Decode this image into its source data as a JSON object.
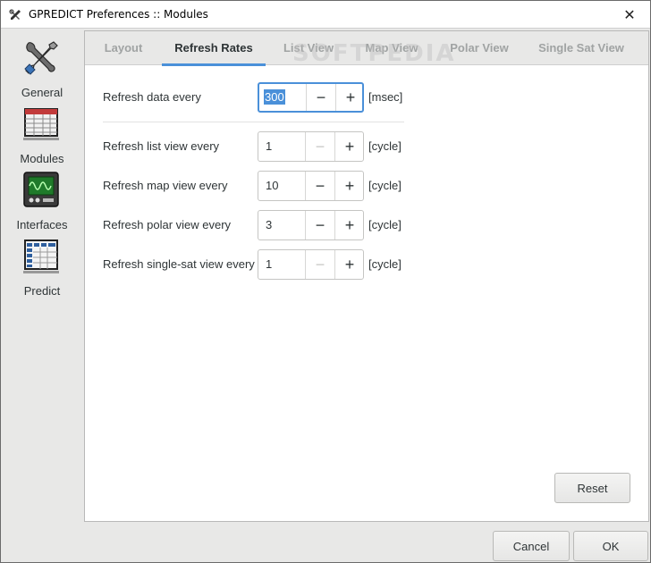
{
  "window": {
    "title": "GPREDICT Preferences :: Modules"
  },
  "sidebar": {
    "items": [
      {
        "label": "General",
        "icon": "tools-icon"
      },
      {
        "label": "Modules",
        "icon": "modules-icon"
      },
      {
        "label": "Interfaces",
        "icon": "interfaces-icon"
      },
      {
        "label": "Predict",
        "icon": "predict-icon"
      }
    ]
  },
  "tabs": [
    {
      "label": "Layout",
      "active": false
    },
    {
      "label": "Refresh Rates",
      "active": true
    },
    {
      "label": "List View",
      "active": false
    },
    {
      "label": "Map View",
      "active": false
    },
    {
      "label": "Polar View",
      "active": false
    },
    {
      "label": "Single Sat View",
      "active": false
    }
  ],
  "watermark": "SOFTPEDIA",
  "settings": {
    "data": {
      "label": "Refresh data every",
      "value": "300",
      "unit": "[msec]",
      "minus_enabled": true
    },
    "list": {
      "label": "Refresh list view every",
      "value": "1",
      "unit": "[cycle]",
      "minus_enabled": false
    },
    "map": {
      "label": "Refresh map view every",
      "value": "10",
      "unit": "[cycle]",
      "minus_enabled": true
    },
    "polar": {
      "label": "Refresh polar view every",
      "value": "3",
      "unit": "[cycle]",
      "minus_enabled": true
    },
    "singlesat": {
      "label": "Refresh single-sat view every",
      "value": "1",
      "unit": "[cycle]",
      "minus_enabled": false
    }
  },
  "spin": {
    "minus": "−",
    "plus": "+"
  },
  "buttons": {
    "reset": "Reset",
    "cancel": "Cancel",
    "ok": "OK",
    "close": "✕"
  },
  "colors": {
    "accent": "#4a90d9"
  }
}
